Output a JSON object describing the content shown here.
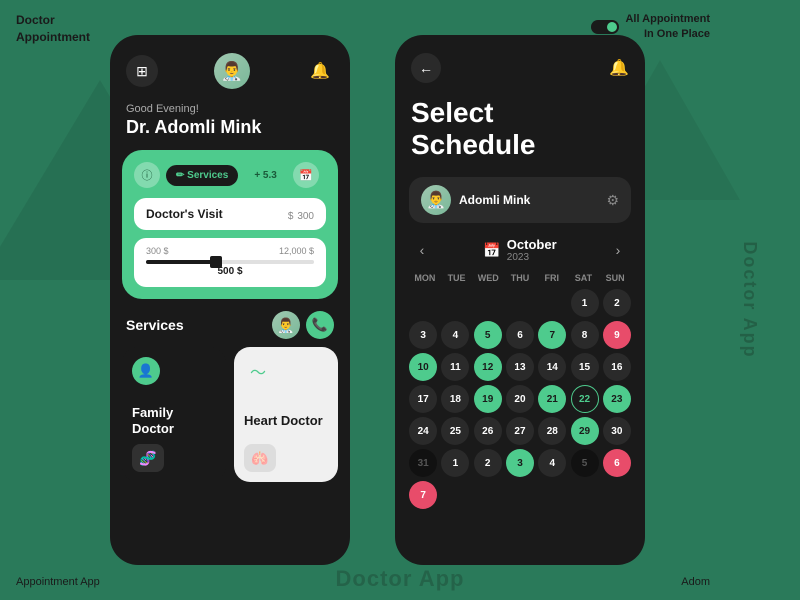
{
  "app": {
    "title_line1": "Doctor",
    "title_line2": "Appointment",
    "header_right_text": "All Appointment\nIn One Place",
    "footer_left": "Appointment App",
    "footer_right": "Adom",
    "rotated_label": "Doctor App",
    "bottom_title": "Doctor App"
  },
  "left_phone": {
    "greeting": "Good Evening!",
    "doctor_name": "Dr. Adomli Mink",
    "tabs": [
      {
        "label": "ⓘ",
        "active": false
      },
      {
        "label": "✏ Services",
        "active": true
      },
      {
        "label": "+ 5.3",
        "active": false
      },
      {
        "label": "📅",
        "active": false
      }
    ],
    "visit": {
      "label": "Doctor's Visit",
      "price": "300",
      "currency": "$"
    },
    "slider": {
      "min": "300 $",
      "max": "12,000 $",
      "value": "500 $"
    },
    "services_title": "Services",
    "service_cards": [
      {
        "name": "Family\nDoctor",
        "theme": "dark"
      },
      {
        "name": "Heart\nDoctor",
        "theme": "light"
      }
    ]
  },
  "right_phone": {
    "title_line1": "Select",
    "title_line2": "Schedule",
    "doctor_name": "Adomli Mink",
    "month": "October",
    "year": "2023",
    "day_headers": [
      "MON",
      "TUE",
      "WED",
      "THU",
      "FRI",
      "SAT",
      "SUN"
    ],
    "calendar_rows": [
      [
        {
          "num": "",
          "style": "empty"
        },
        {
          "num": "",
          "style": "empty"
        },
        {
          "num": "",
          "style": "empty"
        },
        {
          "num": "",
          "style": "empty"
        },
        {
          "num": "",
          "style": "empty"
        },
        {
          "num": "1",
          "style": "normal"
        },
        {
          "num": "2",
          "style": "normal"
        }
      ],
      [
        {
          "num": "3",
          "style": "normal"
        },
        {
          "num": "4",
          "style": "normal"
        },
        {
          "num": "5",
          "style": "green"
        },
        {
          "num": "6",
          "style": "normal"
        },
        {
          "num": "7",
          "style": "green"
        },
        {
          "num": "8",
          "style": "normal"
        },
        {
          "num": "9",
          "style": "red"
        }
      ],
      [
        {
          "num": "10",
          "style": "green"
        },
        {
          "num": "11",
          "style": "normal"
        },
        {
          "num": "12",
          "style": "green"
        },
        {
          "num": "13",
          "style": "normal"
        },
        {
          "num": "14",
          "style": "normal"
        },
        {
          "num": "15",
          "style": "normal"
        },
        {
          "num": "16",
          "style": "normal"
        },
        {
          "num": "17",
          "style": "normal"
        }
      ],
      [
        {
          "num": "18",
          "style": "normal"
        },
        {
          "num": "19",
          "style": "green"
        },
        {
          "num": "20",
          "style": "normal"
        },
        {
          "num": "21",
          "style": "green"
        },
        {
          "num": "22",
          "style": "outline"
        },
        {
          "num": "23",
          "style": "green"
        },
        {
          "num": "24",
          "style": "normal"
        }
      ],
      [
        {
          "num": "25",
          "style": "normal"
        },
        {
          "num": "26",
          "style": "normal"
        },
        {
          "num": "27",
          "style": "normal"
        },
        {
          "num": "28",
          "style": "normal"
        },
        {
          "num": "29",
          "style": "green"
        },
        {
          "num": "30",
          "style": "normal"
        },
        {
          "num": "31",
          "style": "dark"
        }
      ],
      [
        {
          "num": "1",
          "style": "normal"
        },
        {
          "num": "2",
          "style": "normal"
        },
        {
          "num": "3",
          "style": "green"
        },
        {
          "num": "4",
          "style": "normal"
        },
        {
          "num": "5",
          "style": "dark"
        },
        {
          "num": "6",
          "style": "red"
        },
        {
          "num": "7",
          "style": "red"
        }
      ]
    ]
  }
}
